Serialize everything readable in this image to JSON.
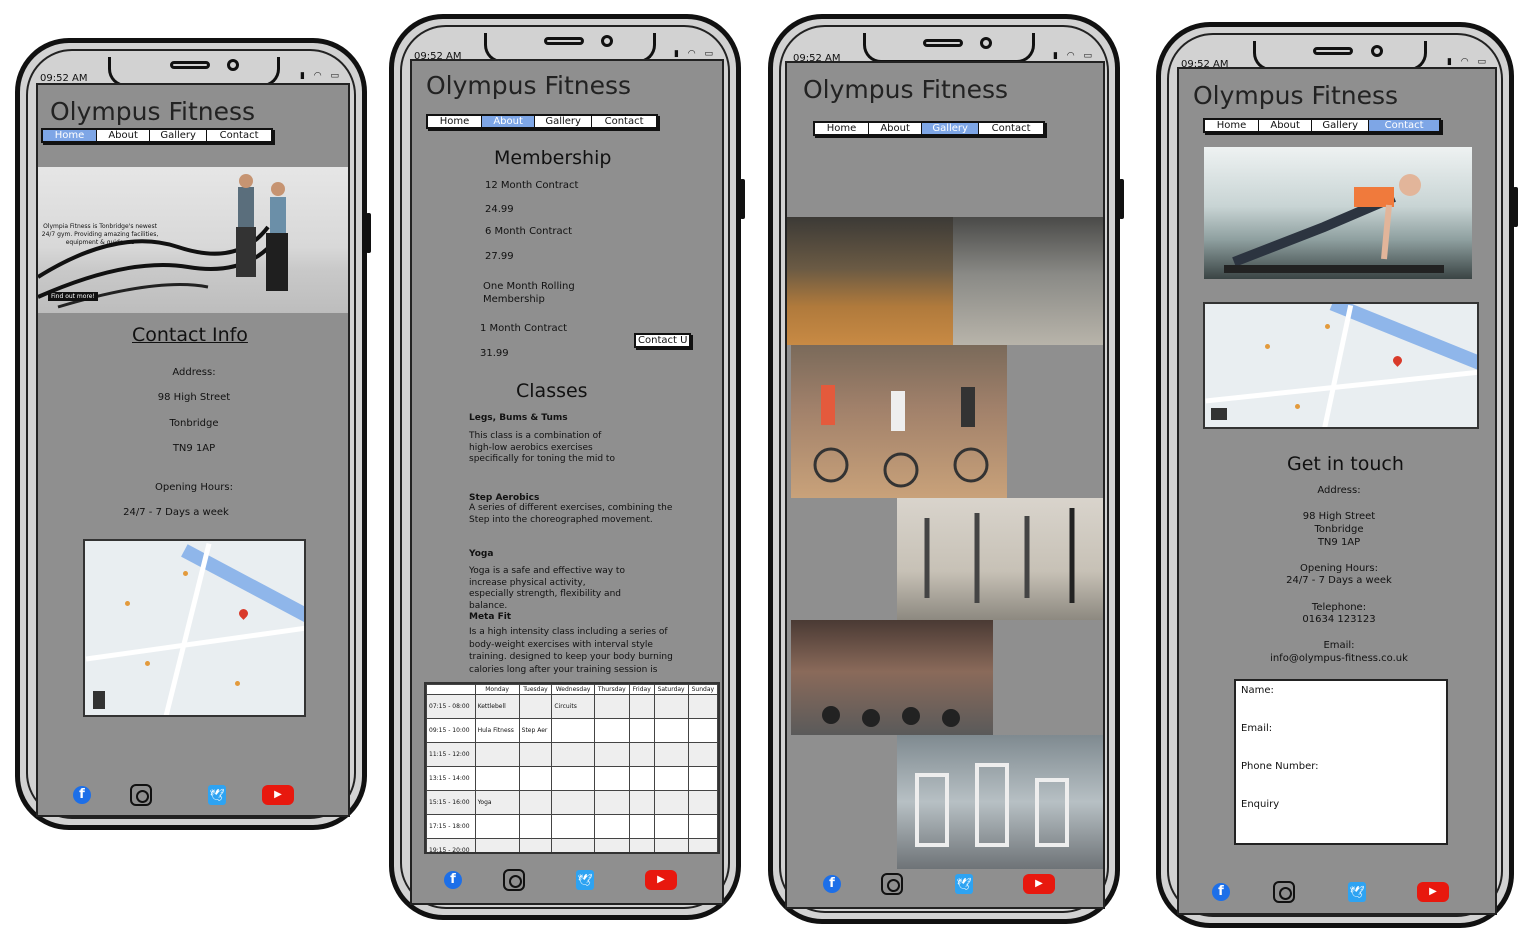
{
  "app": {
    "brand": "Olympus Fitness",
    "status_time": "09:52 AM",
    "status_icons": "▮ ◠ ▭",
    "nav": [
      "Home",
      "About",
      "Gallery",
      "Contact"
    ]
  },
  "social": {
    "facebook_icon": "f",
    "twitter_icon": "🕊",
    "youtube_icon": "▶"
  },
  "home": {
    "active_tab": "Home",
    "hero_caption": "Olympia Fitness is Tonbridge's newest 24/7 gym. Providing amazing facilities, equipment & guidance",
    "hero_button": "Find out more!",
    "contact_heading": "Contact Info",
    "address_label": "Address:",
    "address_lines": [
      "98 High Street",
      "Tonbridge",
      "TN9 1AP"
    ],
    "hours_label": "Opening Hours:",
    "hours_value": "24/7 - 7 Days a week"
  },
  "about": {
    "active_tab": "About",
    "membership_heading": "Membership",
    "plans": [
      {
        "name": "12 Month Contract",
        "price": "24.99"
      },
      {
        "name": "6 Month Contract",
        "price": "27.99"
      },
      {
        "name": "One Month Rolling\nMembership",
        "price": ""
      },
      {
        "name": "1 Month Contract",
        "price": "31.99"
      }
    ],
    "contact_button": "Contact U",
    "classes_heading": "Classes",
    "classes": [
      {
        "title": "Legs, Bums & Tums",
        "desc": "This class is a combination of\nhigh-low aerobics exercises\nspecifically for toning the mid to"
      },
      {
        "title": "Step Aerobics",
        "desc": "A series of different exercises, combining the\nStep into the choreographed movement."
      },
      {
        "title": "Yoga",
        "desc": "Yoga is a safe and effective way to\nincrease physical activity,\nespecially strength, flexibility and\nbalance."
      },
      {
        "title": "Meta Fit",
        "desc": "Is a high intensity class including a series of\nbody-weight exercises with interval style\ntraining. designed to keep your body burning\ncalories long after your training session is"
      }
    ],
    "timetable": {
      "days": [
        "Monday",
        "Tuesday",
        "Wednesday",
        "Thursday",
        "Friday",
        "Saturday",
        "Sunday"
      ],
      "rows": [
        {
          "time": "07:15 - 08:00",
          "cells": [
            "Kettlebell",
            "",
            "Circuits",
            "",
            "",
            "",
            ""
          ]
        },
        {
          "time": "09:15 - 10:00",
          "cells": [
            "Hula Fitness",
            "Step Aer",
            "",
            "",
            "",
            "",
            ""
          ]
        },
        {
          "time": "11:15 - 12:00",
          "cells": [
            "",
            "",
            "",
            "",
            "",
            "",
            ""
          ]
        },
        {
          "time": "13:15 - 14:00",
          "cells": [
            "",
            "",
            "",
            "",
            "",
            "",
            ""
          ]
        },
        {
          "time": "15:15 - 16:00",
          "cells": [
            "Yoga",
            "",
            "",
            "",
            "",
            "",
            ""
          ]
        },
        {
          "time": "17:15 - 18:00",
          "cells": [
            "",
            "",
            "",
            "",
            "",
            "",
            ""
          ]
        },
        {
          "time": "19:15 - 20:00",
          "cells": [
            "",
            "",
            "",
            "",
            "",
            "",
            ""
          ]
        }
      ]
    }
  },
  "gallery": {
    "active_tab": "Gallery"
  },
  "contact": {
    "active_tab": "Contact",
    "heading": "Get in touch",
    "address_label": "Address:",
    "address_lines": [
      "98 High Street",
      "Tonbridge",
      "TN9 1AP"
    ],
    "hours_label": "Opening Hours:",
    "hours_value": "24/7 - 7 Days a week",
    "phone_label": "Telephone:",
    "phone_value": "01634 123123",
    "email_label": "Email:",
    "email_value": "info@olympus-fitness.co.uk",
    "form_fields": [
      "Name:",
      "Email:",
      "Phone Number:",
      "Enquiry"
    ]
  },
  "colors": {
    "screen_bg": "#8f8f8f",
    "nav_active": "#7ea6e6",
    "facebook": "#1d6fe8",
    "twitter": "#2ea3f2",
    "youtube": "#e8180e"
  }
}
